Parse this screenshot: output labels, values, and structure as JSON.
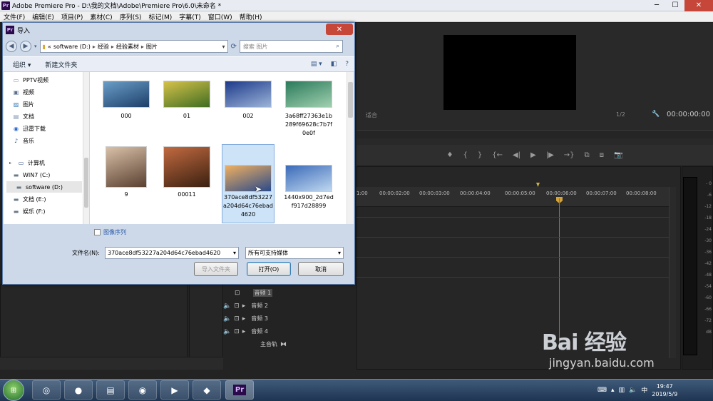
{
  "premiere": {
    "logo": "Pr",
    "title": "Adobe Premiere Pro - D:\\我的文档\\Adobe\\Premiere Pro\\6.0\\未命名 *",
    "menus": [
      "文件(F)",
      "编辑(E)",
      "项目(P)",
      "素材(C)",
      "序列(S)",
      "标记(M)",
      "字幕(T)",
      "窗口(W)",
      "帮助(H)"
    ],
    "program_timecode": "00:00:00:00",
    "fit_label": "适合",
    "zoom_label": "1/2",
    "ruler_ticks": [
      "1:00",
      "00:00:02:00",
      "00:00:03:00",
      "00:00:04:00",
      "00:00:05:00",
      "00:00:06:00",
      "00:00:07:00",
      "00:00:08:00"
    ],
    "audio_tracks": [
      "音频 1",
      "音频 2",
      "音频 3",
      "音频 4",
      "主音轨"
    ]
  },
  "dialog": {
    "title": "导入",
    "close_glyph": "✕",
    "address_parts": [
      "«",
      "software (D:)",
      "经验",
      "经验素材",
      "图片"
    ],
    "search_placeholder": "搜索 图片",
    "toolbar": {
      "organize": "组织 ▾",
      "new_folder": "新建文件夹"
    },
    "nav_items": [
      {
        "label": "PPTV视频",
        "icon": "video-folder-icon"
      },
      {
        "label": "视频",
        "icon": "video-icon"
      },
      {
        "label": "图片",
        "icon": "picture-icon"
      },
      {
        "label": "文档",
        "icon": "document-icon"
      },
      {
        "label": "迅雷下载",
        "icon": "download-icon"
      },
      {
        "label": "音乐",
        "icon": "music-icon"
      },
      {
        "label": "计算机",
        "icon": "computer-icon"
      },
      {
        "label": "WIN7 (C:)",
        "icon": "drive-icon"
      },
      {
        "label": "software (D:)",
        "icon": "drive-icon"
      },
      {
        "label": "文档 (E:)",
        "icon": "drive-icon"
      },
      {
        "label": "娱乐 (F:)",
        "icon": "drive-icon"
      }
    ],
    "files": [
      {
        "name": "000",
        "colors": [
          "#6a9ec8",
          "#1d3f69"
        ]
      },
      {
        "name": "01",
        "colors": [
          "#d6c24a",
          "#3f6d22"
        ]
      },
      {
        "name": "002",
        "colors": [
          "#1d3a8a",
          "#9cb4d8"
        ]
      },
      {
        "name": "3a68ff27363e1b289f69628c7b7f0e0f",
        "colors": [
          "#2a7a5a",
          "#a0d0b0"
        ]
      },
      {
        "name": "9",
        "colors": [
          "#d8c0a8",
          "#5a4030"
        ]
      },
      {
        "name": "00011",
        "colors": [
          "#c26a40",
          "#3a2010"
        ]
      },
      {
        "name": "370ace8df53227a204d64c76ebad4620",
        "colors": [
          "#f0b060",
          "#2a4a8a"
        ]
      },
      {
        "name": "1440x900_2d7edf917d28899",
        "colors": [
          "#3a6ab8",
          "#c0d8f0"
        ]
      }
    ],
    "image_sequence": "图像序列",
    "filename_label": "文件名(N):",
    "filename_value": "370ace8df53227a204d64c76ebad4620",
    "filetype_value": "所有可支持媒体",
    "btn_import_folder": "导入文件夹",
    "btn_open": "打开(O)",
    "btn_cancel": "取消"
  },
  "taskbar": {
    "time": "19:47",
    "date": "2019/5/9"
  },
  "watermark": {
    "logo": "Bai 经验",
    "url": "jingyan.baidu.com"
  }
}
